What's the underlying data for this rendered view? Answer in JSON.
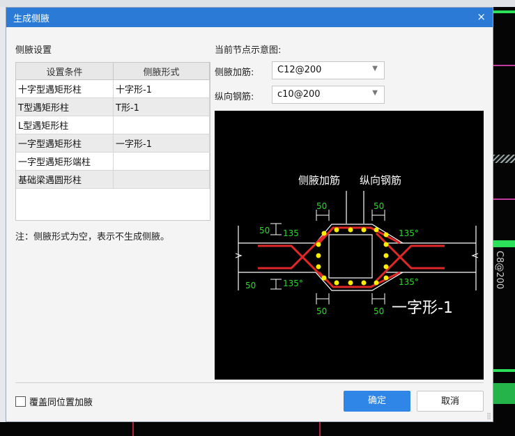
{
  "dialog": {
    "title": "生成侧腋",
    "close_glyph": "×"
  },
  "settings": {
    "section_label": "侧腋设置",
    "columns": [
      "设置条件",
      "侧腋形式"
    ],
    "rows": [
      {
        "condition": "十字型遇矩形柱",
        "form": "十字形-1"
      },
      {
        "condition": "T型遇矩形柱",
        "form": "T形-1"
      },
      {
        "condition": "L型遇矩形柱",
        "form": ""
      },
      {
        "condition": "一字型遇矩形柱",
        "form": "一字形-1"
      },
      {
        "condition": "一字型遇矩形端柱",
        "form": ""
      },
      {
        "condition": "基础梁遇圆形柱",
        "form": ""
      }
    ],
    "note": "注：侧腋形式为空，表示不生成侧腋。"
  },
  "preview_panel": {
    "label": "当前节点示意图:",
    "side_rebar_label": "侧腋加筋:",
    "side_rebar_value": "C12@200",
    "long_rebar_label": "纵向钢筋:",
    "long_rebar_value": "c10@200"
  },
  "diagram": {
    "label_side": "侧腋加筋",
    "label_long": "纵向钢筋",
    "dim_50": "50",
    "angle_135": "135°",
    "angle_135_short": "135",
    "form_name": "一字形-1",
    "colors": {
      "bg": "#000000",
      "rebar": "#e02828",
      "dots": "#ffee00",
      "dim": "#22e022",
      "line": "#ffffff"
    }
  },
  "footer": {
    "overwrite_label": "覆盖同位置加腋",
    "overwrite_checked": false,
    "ok_label": "确定",
    "cancel_label": "取消"
  },
  "background": {
    "vertical_text": "C8@200"
  },
  "icons": {
    "close": "close-icon",
    "dropdown": "chevron-down-icon",
    "resize": "resize-grip-icon"
  }
}
